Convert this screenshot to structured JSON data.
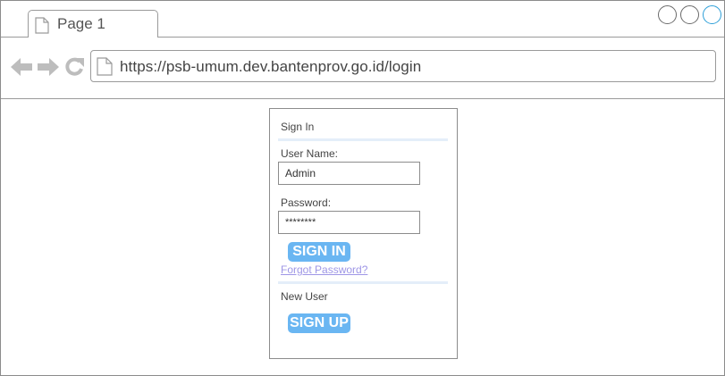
{
  "browser": {
    "tab_label": "Page 1",
    "url": "https://psb-umum.dev.bantenprov.go.id/login",
    "icons": {
      "tab": "document-icon",
      "address": "document-icon",
      "back": "arrow-left-icon",
      "forward": "arrow-right-icon",
      "reload": "reload-icon"
    },
    "window_buttons": [
      "circle-button",
      "circle-button",
      "circle-button"
    ],
    "accent_color": "#2d9fd8"
  },
  "login": {
    "heading": "Sign In",
    "username_label": "User Name:",
    "username_value": "Admin",
    "password_label": "Password:",
    "password_value": "********",
    "signin_label": "SIGN IN",
    "forgot_label": "Forgot Password?",
    "new_user_label": "New User",
    "signup_label": "SIGN UP",
    "button_color": "#6ab6f2",
    "link_color": "#9e96e6"
  }
}
